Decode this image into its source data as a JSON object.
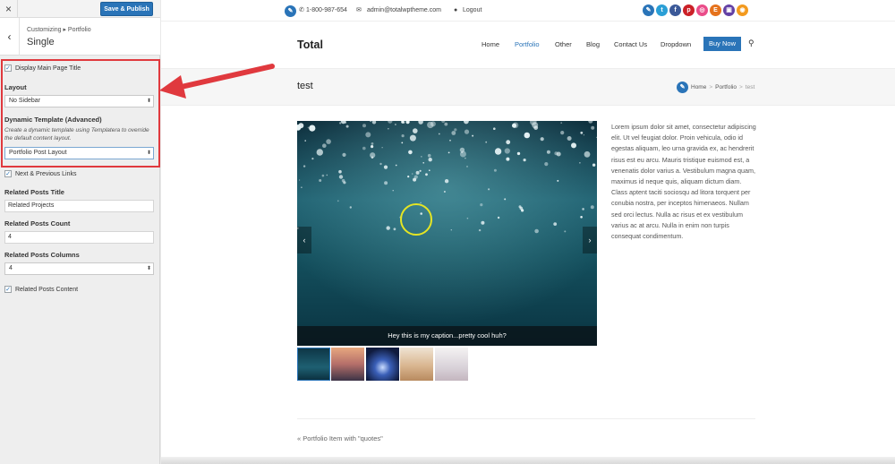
{
  "sidebar": {
    "close_icon": "×",
    "publish_label": "Save & Publish",
    "back_icon": "‹",
    "breadcrumb": "Customizing ▸ Portfolio",
    "section_title": "Single",
    "display_title_label": "Display Main Page Title",
    "layout_label": "Layout",
    "layout_value": "No Sidebar",
    "dynamic_template_label": "Dynamic Template (Advanced)",
    "dynamic_template_desc": "Create a dynamic template using Templatera to override the default content layout.",
    "dynamic_template_value": "Portfolio Post Layout",
    "next_prev_label": "Next & Previous Links",
    "related_title_label": "Related Posts Title",
    "related_title_value": "Related Projects",
    "related_count_label": "Related Posts Count",
    "related_count_value": "4",
    "related_columns_label": "Related Posts Columns",
    "related_columns_value": "4",
    "related_content_label": "Related Posts Content",
    "check_mark": "✓",
    "select_arrow": "⬍"
  },
  "topbar": {
    "phone": "1-800-987-654",
    "email": "admin@totalwptheme.com",
    "logout": "Logout",
    "phone_icon": "phone-icon",
    "email_icon": "envelope-icon",
    "user_icon": "user-icon",
    "social": [
      {
        "name": "edit",
        "color": "#2a74b8",
        "glyph": "✎"
      },
      {
        "name": "twitter",
        "color": "#2a9fd6",
        "glyph": "t"
      },
      {
        "name": "facebook",
        "color": "#3b5998",
        "glyph": "f"
      },
      {
        "name": "pinterest",
        "color": "#cb2027",
        "glyph": "p"
      },
      {
        "name": "dribbble",
        "color": "#ea4c89",
        "glyph": "◎"
      },
      {
        "name": "etsy",
        "color": "#e5721c",
        "glyph": "E"
      },
      {
        "name": "twitch",
        "color": "#6441a5",
        "glyph": "▣"
      },
      {
        "name": "rss",
        "color": "#f39a1e",
        "glyph": "◉"
      }
    ]
  },
  "header": {
    "logo": "Total",
    "nav": [
      "Home",
      "Portfolio",
      "Other",
      "Blog",
      "Contact Us",
      "Dropdown"
    ],
    "buy_label": "Buy Now",
    "search_glyph": "⚲",
    "active_color": "#2a74b8"
  },
  "page": {
    "title": "test",
    "crumb_home": "Home",
    "crumb_portfolio": "Portfolio",
    "crumb_current": "test",
    "crumb_sep": ">",
    "caption": "Hey this is my caption...pretty cool huh?",
    "arrow_left": "‹",
    "arrow_right": "›",
    "body": "Lorem ipsum dolor sit amet, consectetur adipiscing elit. Ut vel feugiat dolor. Proin vehicula, odio id egestas aliquam, leo urna gravida ex, ac hendrerit risus est eu arcu. Mauris tristique euismod est, a venenatis dolor varius a. Vestibulum magna quam, maximus id neque quis, aliquam dictum diam. Class aptent taciti sociosqu ad litora torquent per conubia nostra, per inceptos himenaeos. Nullam sed orci lectus. Nulla ac risus et ex vestibulum varius ac at arcu. Nulla in enim non turpis consequat condimentum.",
    "prev_link": "« Portfolio Item with \"quotes\""
  }
}
